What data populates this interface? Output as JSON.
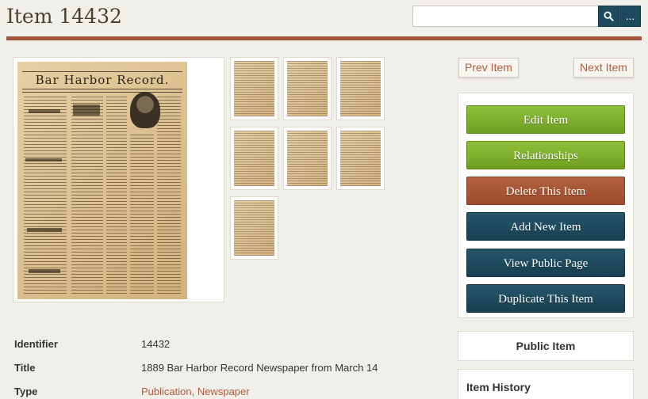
{
  "header": {
    "title": "Item 14432",
    "search_placeholder": "",
    "more_label": "..."
  },
  "image": {
    "newspaper_title": "Bar Harbor Record.",
    "thumbnail_count": 7
  },
  "navigation": {
    "prev_label": "Prev Item",
    "next_label": "Next Item"
  },
  "actions": [
    {
      "label": "Edit Item",
      "style": "green"
    },
    {
      "label": "Relationships",
      "style": "green"
    },
    {
      "label": "Delete This Item",
      "style": "red"
    },
    {
      "label": "Add New Item",
      "style": "navy"
    },
    {
      "label": "View Public Page",
      "style": "navy"
    },
    {
      "label": "Duplicate This Item",
      "style": "navy"
    }
  ],
  "status": {
    "public_label": "Public Item"
  },
  "history": {
    "title": "Item History"
  },
  "metadata": {
    "identifier_label": "Identifier",
    "identifier_value": "14432",
    "title_label": "Title",
    "title_value": "1889 Bar Harbor Record Newspaper from March 14",
    "type_label": "Type",
    "type_value_1": "Publication",
    "type_separator": ", ",
    "type_value_2": "Newspaper"
  },
  "colors": {
    "accent": "#a1543a",
    "link": "#b35a3c",
    "green": "#7fb02e",
    "red": "#a5532f",
    "navy": "#1d4a5c"
  }
}
